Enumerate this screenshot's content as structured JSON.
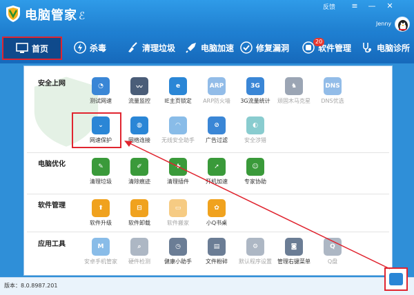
{
  "app": {
    "title": "电脑管家",
    "title_glyph": "ℰ"
  },
  "titlebar": {
    "feedback": "反馈",
    "menu_icon": "≡",
    "minimize_icon": "—",
    "close_icon": "✕"
  },
  "user": {
    "name": "Jenny"
  },
  "nav": [
    {
      "label": "首页",
      "icon": "monitor-icon",
      "active": true
    },
    {
      "label": "杀毒",
      "icon": "lightning-icon"
    },
    {
      "label": "清理垃圾",
      "icon": "broom-icon"
    },
    {
      "label": "电脑加速",
      "icon": "rocket-icon"
    },
    {
      "label": "修复漏洞",
      "icon": "shield-icon"
    },
    {
      "label": "软件管理",
      "icon": "apps-icon",
      "badge": "20"
    },
    {
      "label": "电脑诊所",
      "icon": "stethoscope-icon"
    }
  ],
  "sections": {
    "internet": {
      "label": "安全上网",
      "row1": [
        "测试网速",
        "流量监控",
        "IE主页锁定",
        "ARP防火墙",
        "3G流量统计",
        "顽固木马克星",
        "DNS优选"
      ],
      "row2": [
        "网速保护",
        "网络连接",
        "无线安全助手",
        "广告过滤",
        "安全涉猎"
      ]
    },
    "optimize": {
      "label": "电脑优化",
      "items": [
        "清理垃圾",
        "清除痕迹",
        "清理插件",
        "开机加速",
        "专家协助"
      ]
    },
    "software": {
      "label": "软件管理",
      "items": [
        "软件升级",
        "软件卸载",
        "软件搬家",
        "小Q书桌"
      ]
    },
    "tools": {
      "label": "应用工具",
      "items": [
        "安卓手机管家",
        "硬件检测",
        "健康小助手",
        "文件粉碎",
        "默认程序设置",
        "管理右键菜单",
        "Q盘"
      ]
    }
  },
  "icon_glyphs": {
    "arp": "ARP",
    "g3": "3G",
    "dns": "DNS",
    "q": "Q",
    "m": "M"
  },
  "status": {
    "version": "版本：8.0.8987.201"
  },
  "colors": {
    "accent": "#1f7fd0",
    "highlight": "#e0242f"
  }
}
